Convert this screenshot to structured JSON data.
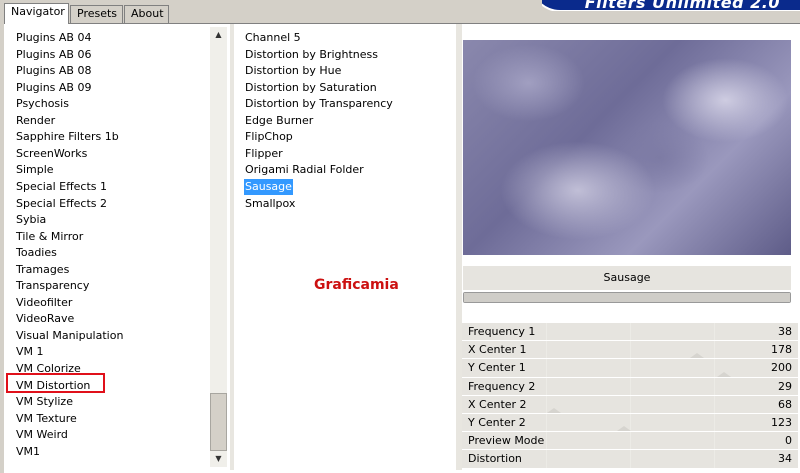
{
  "tabs": [
    {
      "label": "Navigator",
      "active": true
    },
    {
      "label": "Presets",
      "active": false
    },
    {
      "label": "About",
      "active": false
    }
  ],
  "brand": {
    "title": "Filters Unlimited 2.0"
  },
  "categories": [
    "Plugins AB 04",
    "Plugins AB 06",
    "Plugins AB 08",
    "Plugins AB 09",
    "Psychosis",
    "Render",
    "Sapphire Filters 1b",
    "ScreenWorks",
    "Simple",
    "Special Effects 1",
    "Special Effects 2",
    "Sybia",
    "Tile & Mirror",
    "Toadies",
    "Tramages",
    "Transparency",
    "Videofilter",
    "VideoRave",
    "Visual Manipulation",
    "VM 1",
    "VM Colorize",
    "VM Distortion",
    "VM Stylize",
    "VM Texture",
    "VM Weird",
    "VM1"
  ],
  "highlighted_category": "VM Distortion",
  "filters": [
    "Channel 5",
    "Distortion by Brightness",
    "Distortion by Hue",
    "Distortion by Saturation",
    "Distortion by Transparency",
    "Edge Burner",
    "FlipChop",
    "Flipper",
    "Origami Radial Folder",
    "Sausage",
    "Smallpox"
  ],
  "selected_filter": "Sausage",
  "watermark": "Graficamia",
  "filter_name": "Sausage",
  "params": [
    {
      "name": "Frequency 1",
      "value": "38"
    },
    {
      "name": "X Center 1",
      "value": "178"
    },
    {
      "name": "Y Center 1",
      "value": "200"
    },
    {
      "name": "Frequency 2",
      "value": "29"
    },
    {
      "name": "X Center 2",
      "value": "68"
    },
    {
      "name": "Y Center 2",
      "value": "123"
    },
    {
      "name": "Preview Mode",
      "value": "0"
    },
    {
      "name": "Distortion",
      "value": "34"
    }
  ],
  "colors": {
    "selection": "#3399ff",
    "highlight_border": "#e0101a",
    "watermark": "#cc1111",
    "brand": "#0a2a8c"
  },
  "icons": {
    "scroll_up": "up-arrow-icon",
    "scroll_down": "down-arrow-icon"
  }
}
